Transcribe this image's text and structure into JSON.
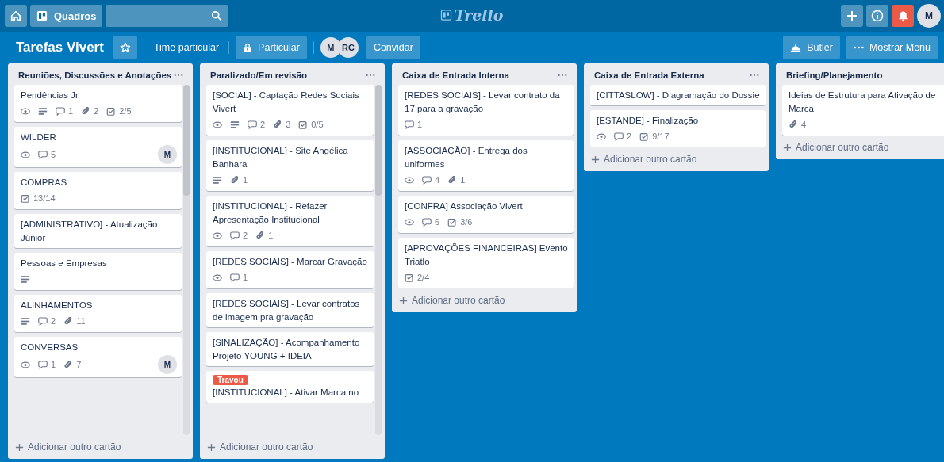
{
  "top_bar": {
    "boards_label": "Quadros",
    "logo": "Trello",
    "user_initial": "M",
    "notifications_alert": true
  },
  "board_header": {
    "title": "Tarefas Vivert",
    "starred": false,
    "team": "Time particular",
    "visibility": "Particular",
    "members": [
      {
        "initials": "M"
      },
      {
        "initials": "RC"
      }
    ],
    "invite": "Convidar",
    "butler": "Butler",
    "menu": "Mostrar Menu"
  },
  "lists": [
    {
      "title": "Reuniões, Discussões e Anotações",
      "add_card": "Adicionar outro cartão",
      "cards": [
        {
          "title": "Pendências Jr",
          "badges": [
            {
              "kind": "watch"
            },
            {
              "kind": "description"
            },
            {
              "kind": "comments",
              "text": "1"
            },
            {
              "kind": "attachments",
              "text": "2"
            },
            {
              "kind": "checklist",
              "text": "2/5"
            }
          ]
        },
        {
          "title": "WILDER",
          "badges": [
            {
              "kind": "watch"
            },
            {
              "kind": "comments",
              "text": "5"
            }
          ],
          "members": [
            "M"
          ]
        },
        {
          "title": "COMPRAS",
          "badges": [
            {
              "kind": "checklist",
              "text": "13/14"
            }
          ]
        },
        {
          "title": "[ADMINISTRATIVO] - Atualização Júnior"
        },
        {
          "title": "Pessoas e Empresas",
          "badges": [
            {
              "kind": "description"
            }
          ]
        },
        {
          "title": "ALINHAMENTOS",
          "badges": [
            {
              "kind": "description"
            },
            {
              "kind": "comments",
              "text": "2"
            },
            {
              "kind": "attachments",
              "text": "11"
            }
          ]
        },
        {
          "title": "CONVERSAS",
          "badges": [
            {
              "kind": "watch"
            },
            {
              "kind": "comments",
              "text": "1"
            },
            {
              "kind": "attachments",
              "text": "7"
            }
          ],
          "members": [
            "M"
          ]
        }
      ]
    },
    {
      "title": "Paralizado/Em revisão",
      "add_card": "Adicionar outro cartão",
      "cards": [
        {
          "title": "[SOCIAL] - Captação Redes Sociais Vivert",
          "badges": [
            {
              "kind": "watch"
            },
            {
              "kind": "description"
            },
            {
              "kind": "comments",
              "text": "2"
            },
            {
              "kind": "attachments",
              "text": "3"
            },
            {
              "kind": "checklist",
              "text": "0/5"
            }
          ]
        },
        {
          "title": "[INSTITUCIONAL] - Site Angélica Banhara",
          "badges": [
            {
              "kind": "description"
            },
            {
              "kind": "attachments",
              "text": "1"
            }
          ]
        },
        {
          "title": "[INSTITUCIONAL] - Refazer Apresentação Institucional",
          "badges": [
            {
              "kind": "watch"
            },
            {
              "kind": "comments",
              "text": "2"
            },
            {
              "kind": "attachments",
              "text": "1"
            }
          ]
        },
        {
          "title": "[REDES SOCIAIS] - Marcar Gravação",
          "badges": [
            {
              "kind": "watch"
            },
            {
              "kind": "comments",
              "text": "1"
            }
          ]
        },
        {
          "title": "[REDES SOCIAIS] - Levar contratos de imagem pra gravação"
        },
        {
          "title": "[SINALIZAÇÃO] - Acompanhamento Projeto YOUNG + IDEIA"
        },
        {
          "title": "[INSTITUCIONAL] - Ativar Marca no",
          "labels": [
            {
              "text": "Travou",
              "color": "#eb5a46"
            }
          ]
        }
      ]
    },
    {
      "title": "Caixa de Entrada Interna",
      "add_card": "Adicionar outro cartão",
      "cards": [
        {
          "title": "[REDES SOCIAIS] - Levar contrato da 17 para a gravação",
          "badges": [
            {
              "kind": "comments",
              "text": "1"
            }
          ]
        },
        {
          "title": "[ASSOCIAÇÃO] - Entrega dos uniformes",
          "badges": [
            {
              "kind": "watch"
            },
            {
              "kind": "comments",
              "text": "4"
            },
            {
              "kind": "attachments",
              "text": "1"
            }
          ]
        },
        {
          "title": "[CONFRA] Associação Vivert",
          "badges": [
            {
              "kind": "watch"
            },
            {
              "kind": "comments",
              "text": "6"
            },
            {
              "kind": "checklist",
              "text": "3/6"
            }
          ]
        },
        {
          "title": "[APROVAÇÕES FINANCEIRAS] Evento Triatlo",
          "badges": [
            {
              "kind": "checklist",
              "text": "2/4"
            }
          ]
        }
      ]
    },
    {
      "title": "Caixa de Entrada Externa",
      "add_card": "Adicionar outro cartão",
      "cards": [
        {
          "title": "[CITTASLOW] - Diagramação do Dossie"
        },
        {
          "title": "[ESTANDE] - Finalização",
          "badges": [
            {
              "kind": "watch"
            },
            {
              "kind": "comments",
              "text": "2"
            },
            {
              "kind": "checklist",
              "text": "9/17"
            }
          ]
        }
      ]
    },
    {
      "title": "Briefing/Planejamento",
      "add_card": "Adicionar outro cartão",
      "cards": [
        {
          "title": "Ideias de Estrutura para Ativação de Marca",
          "badges": [
            {
              "kind": "attachments",
              "text": "4"
            }
          ]
        }
      ]
    }
  ]
}
